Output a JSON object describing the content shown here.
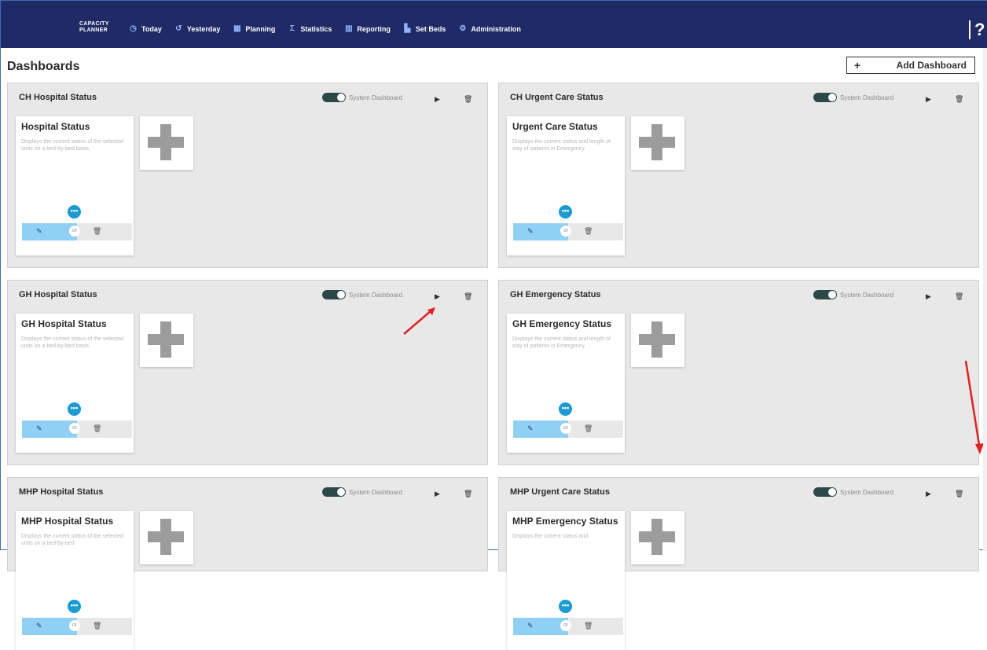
{
  "topbar": {
    "brand_line1": "CAPACITY",
    "brand_line2": "PLANNER",
    "nav": [
      {
        "label": "Today",
        "icon": "clock-icon"
      },
      {
        "label": "Yesterday",
        "icon": "history-icon"
      },
      {
        "label": "Planning",
        "icon": "calendar-icon"
      },
      {
        "label": "Statistics",
        "icon": "sigma-icon"
      },
      {
        "label": "Reporting",
        "icon": "bar-chart-icon"
      },
      {
        "label": "Set Beds",
        "icon": "bed-icon"
      },
      {
        "label": "Administration",
        "icon": "gears-icon"
      }
    ],
    "help_icon": "help-icon"
  },
  "page": {
    "title": "Dashboards",
    "add_button": {
      "icon": "+",
      "label": "Add Dashboard"
    }
  },
  "panels": [
    {
      "title": "CH Hospital Status",
      "system_label": "System Dashboard",
      "widget": {
        "title": "Hospital Status",
        "desc": "Displays the current status of the selected units on a bed-by-bed basis.",
        "or_label": "or"
      }
    },
    {
      "title": "CH Urgent Care Status",
      "system_label": "System Dashboard",
      "widget": {
        "title": "Urgent Care Status",
        "desc": "Displays the current status and length of stay of patients in Emergency.",
        "or_label": "or"
      }
    },
    {
      "title": "GH Hospital Status",
      "system_label": "System Dashboard",
      "widget": {
        "title": "GH Hospital Status",
        "desc": "Displays the current status of the selected units on a bed-by-bed basis.",
        "or_label": "or"
      }
    },
    {
      "title": "GH Emergency Status",
      "system_label": "System Dashboard",
      "widget": {
        "title": "GH Emergency Status",
        "desc": "Displays the current status and length of stay of patients in Emergency.",
        "or_label": "or"
      }
    },
    {
      "title": "MHP Hospital Status",
      "system_label": "System Dashboard",
      "widget": {
        "title": "MHP Hospital Status",
        "desc": "Displays the current status of the selected units on a bed-by-bed",
        "or_label": "or"
      }
    },
    {
      "title": "MHP Urgent Care Status",
      "system_label": "System Dashboard",
      "widget": {
        "title": "MHP Emergency Status",
        "desc": "Displays the current status and",
        "or_label": "or"
      }
    }
  ],
  "colors": {
    "topbar": "#1f2a66",
    "accent": "#1a9bd4",
    "annotation": "#e62020"
  }
}
